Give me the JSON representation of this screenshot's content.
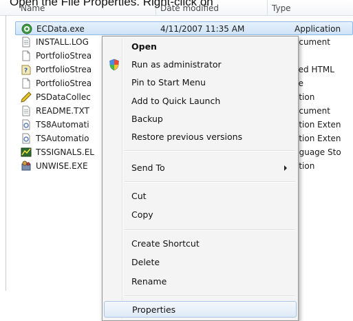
{
  "caption": "Open the File Properties.  Right-click on",
  "columns": {
    "name": "Name",
    "date": "Date modified",
    "type": "Type"
  },
  "files": [
    {
      "name": "ECData.exe",
      "date": "4/11/2007 11:35 AM",
      "type": "Application",
      "icon": "app-gear-icon",
      "selected": true
    },
    {
      "name": "INSTALL.LOG",
      "date": "",
      "type": "ocument",
      "icon": "text-file-icon"
    },
    {
      "name": "PortfolioStrea",
      "date": "",
      "type": "",
      "icon": "blank-file-icon"
    },
    {
      "name": "PortfolioStrea",
      "date": "",
      "type": "iled HTML",
      "icon": "help-file-icon"
    },
    {
      "name": "PortfolioStrea",
      "date": "",
      "type": "ile",
      "icon": "blank-file-icon"
    },
    {
      "name": "PSDataCollec",
      "date": "",
      "type": "ation",
      "icon": "pen-app-icon"
    },
    {
      "name": "README.TXT",
      "date": "",
      "type": "ocument",
      "icon": "text-file-icon"
    },
    {
      "name": "TS8Automati",
      "date": "",
      "type": "ation Exten",
      "icon": "dll-file-icon"
    },
    {
      "name": "TSAutomatio",
      "date": "",
      "type": "ation Exten",
      "icon": "dll-file-icon"
    },
    {
      "name": "TSSIGNALS.EL",
      "date": "",
      "type": "nguage Sto",
      "icon": "chart-file-icon"
    },
    {
      "name": "UNWISE.EXE",
      "date": "",
      "type": "ation",
      "icon": "installer-icon"
    }
  ],
  "menu": {
    "open": "Open",
    "run_as_admin": "Run as administrator",
    "pin_start": "Pin to Start Menu",
    "add_quick_launch": "Add to Quick Launch",
    "backup": "Backup",
    "restore": "Restore previous versions",
    "send_to": "Send To",
    "cut": "Cut",
    "copy": "Copy",
    "create_shortcut": "Create Shortcut",
    "delete": "Delete",
    "rename": "Rename",
    "properties": "Properties"
  },
  "colors": {
    "selection": "#cfe3f7",
    "menu_bg": "#f4f4f4",
    "hover_border": "#a8c5e6"
  }
}
